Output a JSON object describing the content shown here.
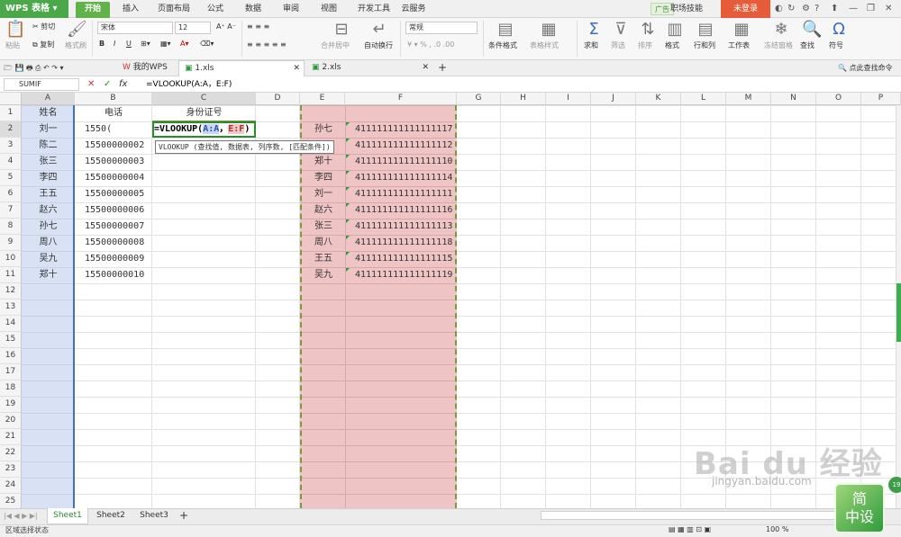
{
  "app": {
    "name": "WPS 表格",
    "login": "未登录",
    "ad_tag": "广告",
    "ad_text": "职场技能"
  },
  "menu": {
    "tabs": [
      "开始",
      "插入",
      "页面布局",
      "公式",
      "数据",
      "审阅",
      "视图",
      "开发工具",
      "云服务"
    ],
    "active": "开始"
  },
  "ribbon": {
    "paste": "粘贴",
    "cut": "剪切",
    "copy": "复制",
    "format_painter": "格式刷",
    "font_name": "宋体",
    "font_size": "12",
    "merge": "合并居中",
    "wrap": "自动换行",
    "number_format": "常规",
    "cond_format": "条件格式",
    "table_style": "表格样式",
    "sum": "求和",
    "filter": "筛选",
    "sort": "排序",
    "format": "格式",
    "rows_cols": "行和列",
    "worksheet": "工作表",
    "freeze": "冻结窗格",
    "find": "查找",
    "symbol": "符号"
  },
  "doc_tabs": [
    {
      "label": "我的WPS"
    },
    {
      "label": "1.xls"
    },
    {
      "label": "2.xls"
    }
  ],
  "doc_search": "点此查找命令",
  "formula_bar": {
    "name_box": "SUMIF",
    "formula": "=VLOOKUP(A:A，E:F)"
  },
  "columns": [
    "A",
    "B",
    "C",
    "D",
    "E",
    "F",
    "G",
    "H",
    "I",
    "J",
    "K",
    "L",
    "M",
    "N",
    "O",
    "P"
  ],
  "rows": [
    "1",
    "2",
    "3",
    "4",
    "5",
    "6",
    "7",
    "8",
    "9",
    "10",
    "11",
    "12",
    "13",
    "14",
    "15",
    "16",
    "17",
    "18",
    "19",
    "20",
    "21",
    "22",
    "23",
    "24",
    "25"
  ],
  "headers": {
    "a": "姓名",
    "b": "电话",
    "c": "身份证号"
  },
  "table_ab": [
    {
      "name": "刘一",
      "phone": "1550("
    },
    {
      "name": "陈二",
      "phone": "15500000002"
    },
    {
      "name": "张三",
      "phone": "15500000003"
    },
    {
      "name": "李四",
      "phone": "15500000004"
    },
    {
      "name": "王五",
      "phone": "15500000005"
    },
    {
      "name": "赵六",
      "phone": "15500000006"
    },
    {
      "name": "孙七",
      "phone": "15500000007"
    },
    {
      "name": "周八",
      "phone": "15500000008"
    },
    {
      "name": "吴九",
      "phone": "15500000009"
    },
    {
      "name": "郑十",
      "phone": "15500000010"
    }
  ],
  "table_ef": [
    {
      "name": "孙七",
      "id": "411111111111111117"
    },
    {
      "name": "",
      "id": "411111111111111112"
    },
    {
      "name": "郑十",
      "id": "411111111111111110"
    },
    {
      "name": "李四",
      "id": "411111111111111114"
    },
    {
      "name": "刘一",
      "id": "411111111111111111"
    },
    {
      "name": "赵六",
      "id": "411111111111111116"
    },
    {
      "name": "张三",
      "id": "411111111111111113"
    },
    {
      "name": "周八",
      "id": "411111111111111118"
    },
    {
      "name": "王五",
      "id": "411111111111111115"
    },
    {
      "name": "吴九",
      "id": "411111111111111119"
    }
  ],
  "cell_formula": {
    "prefix": "=VLOOKUP(",
    "ref1": "A:A",
    "sep": "，",
    "ref2": "E:F",
    "suffix": ")"
  },
  "tooltip": "VLOOKUP (查找值, 数据表, 列序数, [匹配条件])",
  "sheets": [
    "Sheet1",
    "Sheet2",
    "Sheet3"
  ],
  "active_sheet": "Sheet1",
  "status": {
    "mode": "区域选择状态",
    "zoom": "100 %"
  },
  "watermark": {
    "text": "Bai du 经验",
    "sub": "jingyan.baidu.com"
  },
  "badge": {
    "line1": "简",
    "line2": "中设",
    "circle": "19"
  }
}
